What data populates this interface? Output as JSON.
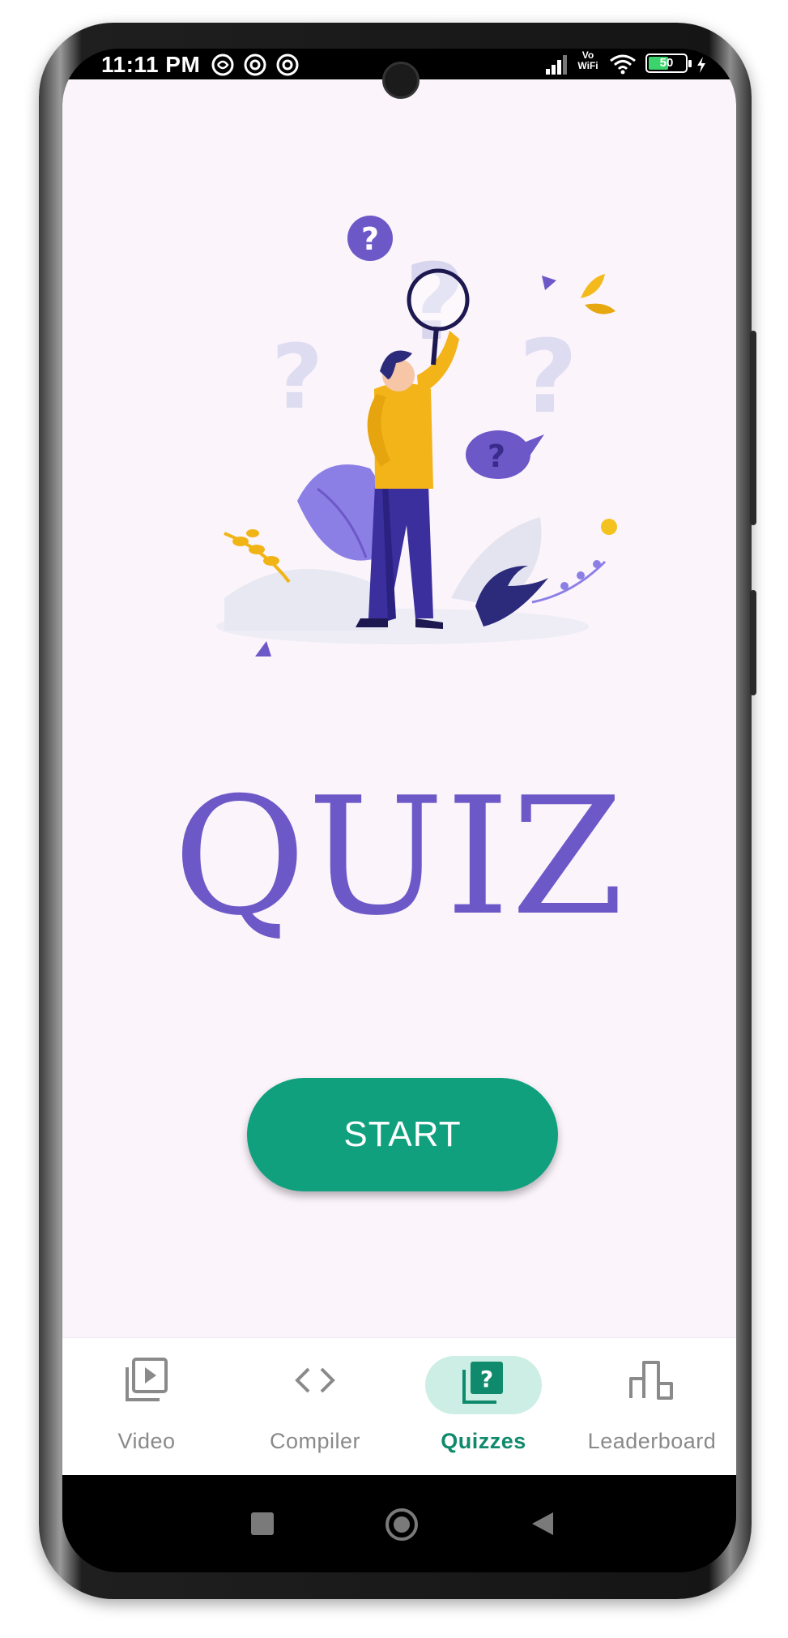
{
  "status_bar": {
    "time": "11:11 PM",
    "network_label": "Vo WiFi",
    "battery": "50"
  },
  "main": {
    "title": "QUIZ",
    "start_button": "START",
    "illustration": "person-with-magnifying-glass-question-marks",
    "accent_color": "#6d58c8",
    "button_color": "#10a07e"
  },
  "bottom_nav": {
    "items": [
      {
        "label": "Video",
        "icon": "video-library-icon",
        "active": false
      },
      {
        "label": "Compiler",
        "icon": "code-brackets-icon",
        "active": false
      },
      {
        "label": "Quizzes",
        "icon": "quiz-icon",
        "active": true
      },
      {
        "label": "Leaderboard",
        "icon": "leaderboard-icon",
        "active": false
      }
    ],
    "active_color": "#0f8a6d"
  }
}
